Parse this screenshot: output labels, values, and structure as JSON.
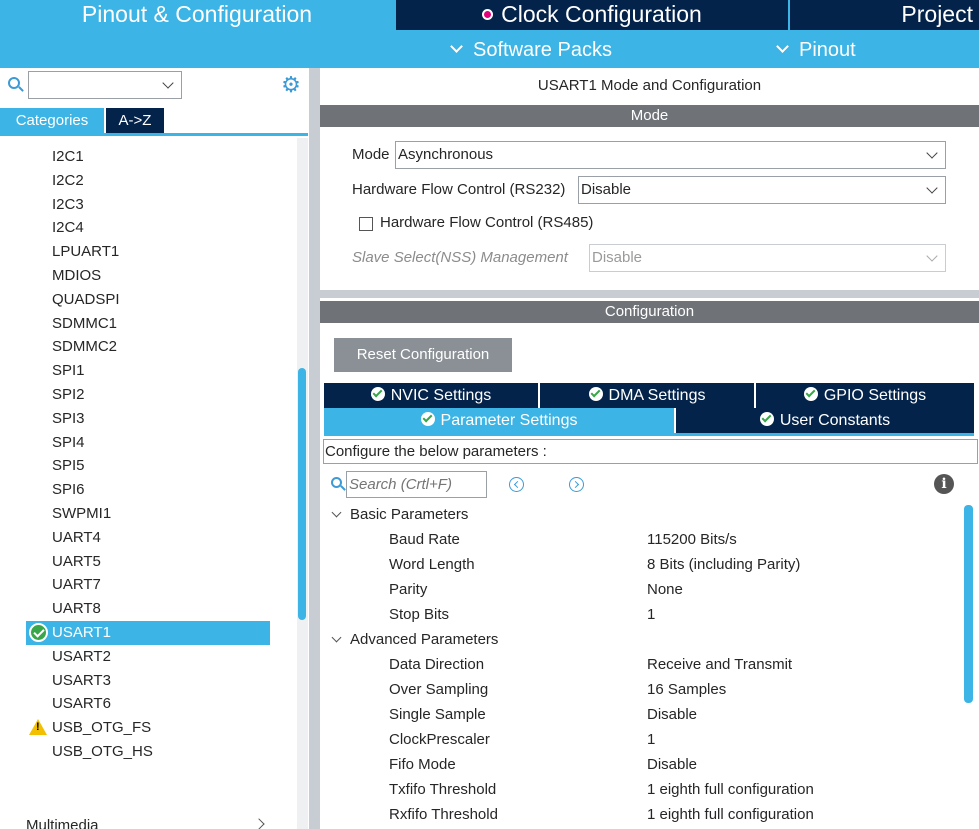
{
  "top_tabs": {
    "pinout": "Pinout & Configuration",
    "clock": "Clock Configuration",
    "project": "Project"
  },
  "sub_menu": {
    "software_packs": "Software Packs",
    "pinout": "Pinout"
  },
  "left": {
    "search_value": "",
    "tabs": {
      "categories": "Categories",
      "atoz": "A->Z"
    },
    "items": [
      {
        "label": "I2C1"
      },
      {
        "label": "I2C2"
      },
      {
        "label": "I2C3"
      },
      {
        "label": "I2C4"
      },
      {
        "label": "LPUART1"
      },
      {
        "label": "MDIOS"
      },
      {
        "label": "QUADSPI"
      },
      {
        "label": "SDMMC1"
      },
      {
        "label": "SDMMC2"
      },
      {
        "label": "SPI1"
      },
      {
        "label": "SPI2"
      },
      {
        "label": "SPI3"
      },
      {
        "label": "SPI4"
      },
      {
        "label": "SPI5"
      },
      {
        "label": "SPI6"
      },
      {
        "label": "SWPMI1"
      },
      {
        "label": "UART4"
      },
      {
        "label": "UART5"
      },
      {
        "label": "UART7"
      },
      {
        "label": "UART8"
      },
      {
        "label": "USART1",
        "status": "ok",
        "selected": true
      },
      {
        "label": "USART2"
      },
      {
        "label": "USART3"
      },
      {
        "label": "USART6"
      },
      {
        "label": "USB_OTG_FS",
        "status": "warning"
      },
      {
        "label": "USB_OTG_HS"
      }
    ],
    "multimedia": "Multimedia"
  },
  "right": {
    "title": "USART1 Mode and Configuration",
    "mode_header": "Mode",
    "mode": {
      "mode_label": "Mode",
      "mode_value": "Asynchronous",
      "hfc232_label": "Hardware Flow Control (RS232)",
      "hfc232_value": "Disable",
      "hfc485_label": "Hardware Flow Control (RS485)",
      "hfc485_checked": false,
      "nss_label": "Slave Select(NSS) Management",
      "nss_value": "Disable"
    },
    "config_header": "Configuration",
    "reset_button": "Reset Configuration",
    "tabs": {
      "nvic": "NVIC Settings",
      "dma": "DMA Settings",
      "gpio": "GPIO Settings",
      "parameter": "Parameter Settings",
      "user_constants": "User Constants"
    },
    "hint": "Configure the below parameters :",
    "search_placeholder": "Search (Crtl+F)",
    "groups": {
      "basic": "Basic Parameters",
      "advanced": "Advanced Parameters"
    },
    "basic_params": [
      {
        "name": "Baud Rate",
        "value": "115200 Bits/s"
      },
      {
        "name": "Word Length",
        "value": "8 Bits (including Parity)"
      },
      {
        "name": "Parity",
        "value": "None"
      },
      {
        "name": "Stop Bits",
        "value": "1"
      }
    ],
    "advanced_params": [
      {
        "name": "Data Direction",
        "value": "Receive and Transmit"
      },
      {
        "name": "Over Sampling",
        "value": "16 Samples"
      },
      {
        "name": "Single Sample",
        "value": "Disable"
      },
      {
        "name": "ClockPrescaler",
        "value": "1"
      },
      {
        "name": "Fifo Mode",
        "value": "Disable"
      },
      {
        "name": "Txfifo Threshold",
        "value": "1 eighth full configuration"
      },
      {
        "name": "Rxfifo Threshold",
        "value": "1 eighth full configuration"
      }
    ]
  },
  "colors": {
    "accent": "#3cb4e5",
    "dark_navy": "#03234b",
    "section_gray": "#6f7377",
    "ok_green": "#3aa64a",
    "warning_yellow": "#f2c000"
  }
}
